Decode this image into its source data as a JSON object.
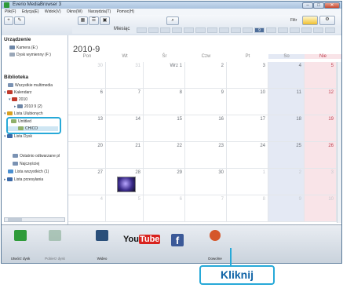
{
  "window": {
    "title": "Everio MediaBrowser 3",
    "controls": [
      "–",
      "□",
      "✕"
    ]
  },
  "menu": [
    "Plik(F)",
    "Edycja(E)",
    "Widok(V)",
    "Okno(W)",
    "Narzędzia(T)",
    "Pomoc(H)"
  ],
  "toolbar": {
    "month_label": "Miesiąc",
    "highlighted_tab": "9",
    "filter_label": "Filtr"
  },
  "sidebar": {
    "devices_header": "Urządzenie",
    "devices": [
      "Kamera (E:)",
      "Dysk wymienny (F:)"
    ],
    "library_header": "Biblioteka",
    "library_items": [
      "Wszystkie multimedia",
      "Kalendarz",
      "2010",
      "2010 9 (2)",
      "Lista Ulubionych",
      "Untitled",
      "CHICO",
      "Lista Dysk",
      "Ostatnio odtwarzane pl",
      "Najczęściej",
      "Lista wszystkich (1)",
      "Lista przesyłania"
    ]
  },
  "calendar": {
    "month_title": "2010-9",
    "days": [
      "Pon",
      "Wt",
      "Śr",
      "Czw",
      "Pt",
      "So",
      "Nie"
    ],
    "rows": [
      [
        "30",
        "31",
        "1",
        "2",
        "3",
        "4",
        "5"
      ],
      [
        "6",
        "7",
        "8",
        "9",
        "10",
        "11",
        "12"
      ],
      [
        "13",
        "14",
        "15",
        "16",
        "17",
        "18",
        "19"
      ],
      [
        "20",
        "21",
        "22",
        "23",
        "24",
        "25",
        "26"
      ],
      [
        "27",
        "28",
        "29",
        "30",
        "1",
        "2",
        "3"
      ],
      [
        "4",
        "5",
        "6",
        "7",
        "8",
        "9",
        "10"
      ]
    ],
    "first_day_prefix": "Wrz"
  },
  "bottom_buttons": [
    {
      "label": "Utwórz dysk",
      "icon": "disc-create-icon"
    },
    {
      "label": "Pobierz dysk",
      "icon": "download-disc-icon"
    },
    {
      "label": "Wideo",
      "icon": "video-icon"
    },
    {
      "label": "You",
      "icon": "youtube-icon"
    },
    {
      "label": "",
      "icon": "facebook-icon"
    },
    {
      "label": "Dowolne",
      "icon": "upload-icon"
    }
  ],
  "youtube_logo": {
    "you": "You",
    "tube": "Tube"
  },
  "facebook_letter": "f",
  "callout": "Kliknij",
  "colors": {
    "accent": "#27a9d8",
    "callout_text": "#0f63a6",
    "saturday": "#e4e9f4",
    "sunday": "#f9e4e8",
    "highlight_tab": "#4e6e9a"
  }
}
